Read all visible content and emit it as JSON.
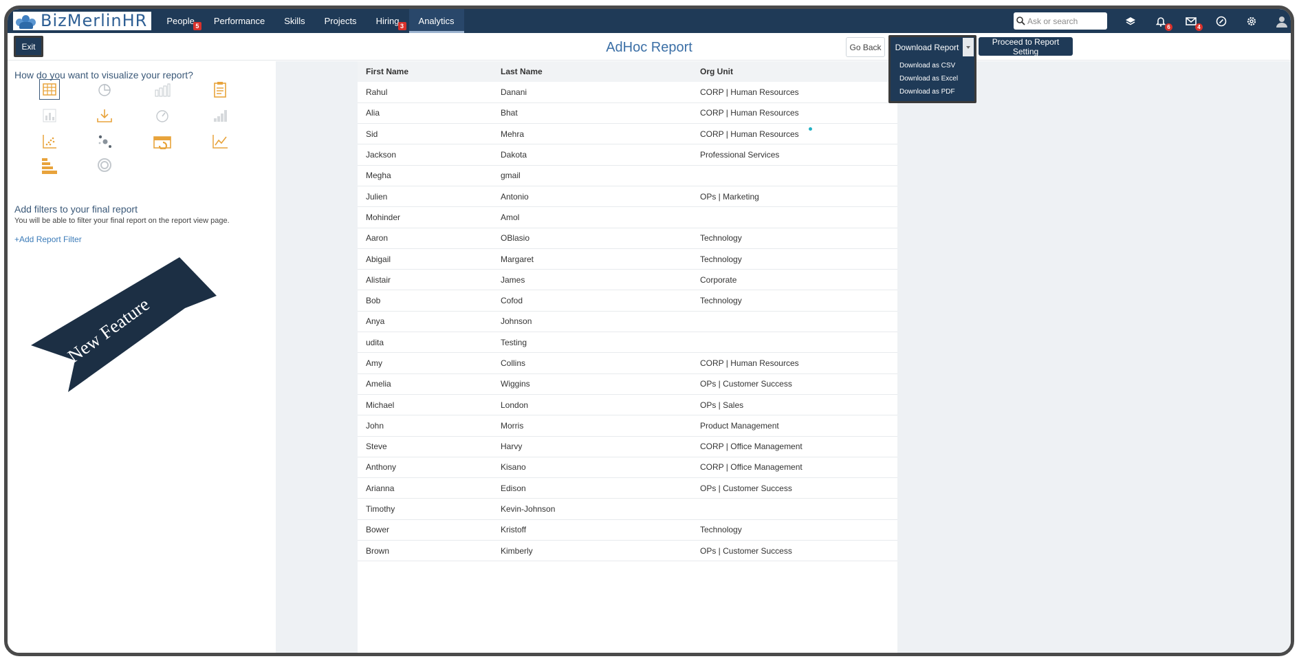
{
  "brand": {
    "name": "BizMerlinHR"
  },
  "nav": {
    "items": [
      {
        "label": "People",
        "badge": "5"
      },
      {
        "label": "Performance",
        "badge": ""
      },
      {
        "label": "Skills",
        "badge": ""
      },
      {
        "label": "Projects",
        "badge": ""
      },
      {
        "label": "Hiring",
        "badge": "3"
      },
      {
        "label": "Analytics",
        "badge": "",
        "active": true
      }
    ],
    "search_placeholder": "Ask or search",
    "tools": [
      {
        "icon": "layers-icon",
        "badge": ""
      },
      {
        "icon": "bell-icon",
        "badge": "6"
      },
      {
        "icon": "mail-icon",
        "badge": "4"
      },
      {
        "icon": "help-icon",
        "badge": ""
      },
      {
        "icon": "gear-icon",
        "badge": ""
      },
      {
        "icon": "avatar-icon",
        "badge": ""
      }
    ]
  },
  "header": {
    "exit_label": "Exit",
    "title": "AdHoc Report",
    "go_back_label": "Go Back",
    "download_label": "Download Report",
    "download_menu": [
      "Download as CSV",
      "Download as Excel",
      "Download as PDF"
    ],
    "proceed_label": "Proceed to Report Setting"
  },
  "left_panel": {
    "viz_heading": "How do you want to visualize your report?",
    "viz_icons": [
      "table-icon",
      "pie-chart-icon",
      "bar-chart-icon",
      "clipboard-icon",
      "column-chart-icon",
      "download-icon",
      "gauge-icon",
      "step-chart-icon",
      "scatter-icon",
      "bubble-icon",
      "calendar-icon",
      "line-chart-icon",
      "horizontal-bar-icon",
      "donut-icon"
    ],
    "filter_heading": "Add filters to your final report",
    "filter_note": "You will be able to filter your final report on the report view page.",
    "add_filter_label": "+Add Report Filter",
    "ribbon_text": "New Feature"
  },
  "table": {
    "columns": [
      "First Name",
      "Last Name",
      "Org Unit"
    ],
    "rows": [
      [
        "Rahul",
        "Danani",
        "CORP | Human Resources"
      ],
      [
        "Alia",
        "Bhat",
        "CORP | Human Resources"
      ],
      [
        "Sid",
        "Mehra",
        "CORP | Human Resources"
      ],
      [
        "Jackson",
        "Dakota",
        "Professional Services"
      ],
      [
        "Megha",
        "gmail",
        ""
      ],
      [
        "Julien",
        "Antonio",
        "OPs | Marketing"
      ],
      [
        "Mohinder",
        "Amol",
        ""
      ],
      [
        "Aaron",
        "OBlasio",
        "Technology"
      ],
      [
        "Abigail",
        "Margaret",
        "Technology"
      ],
      [
        "Alistair",
        "James",
        "Corporate"
      ],
      [
        "Bob",
        "Cofod",
        "Technology"
      ],
      [
        "Anya",
        "Johnson",
        ""
      ],
      [
        "udita",
        "Testing",
        ""
      ],
      [
        "Amy",
        "Collins",
        "CORP | Human Resources"
      ],
      [
        "Amelia",
        "Wiggins",
        "OPs | Customer Success"
      ],
      [
        "Michael",
        "London",
        "OPs | Sales"
      ],
      [
        "John",
        "Morris",
        "Product Management"
      ],
      [
        "Steve",
        "Harvy",
        "CORP | Office Management"
      ],
      [
        "Anthony",
        "Kisano",
        "CORP | Office Management"
      ],
      [
        "Arianna",
        "Edison",
        "OPs | Customer Success"
      ],
      [
        "Timothy",
        "Kevin-Johnson",
        ""
      ],
      [
        "Bower",
        "Kristoff",
        "Technology"
      ],
      [
        "Brown",
        "Kimberly",
        "OPs | Customer Success"
      ]
    ]
  },
  "colors": {
    "nav_bg": "#1f3a57",
    "accent": "#3b6fa6",
    "badge": "#d9322c",
    "icon_orange": "#e8a33b"
  }
}
